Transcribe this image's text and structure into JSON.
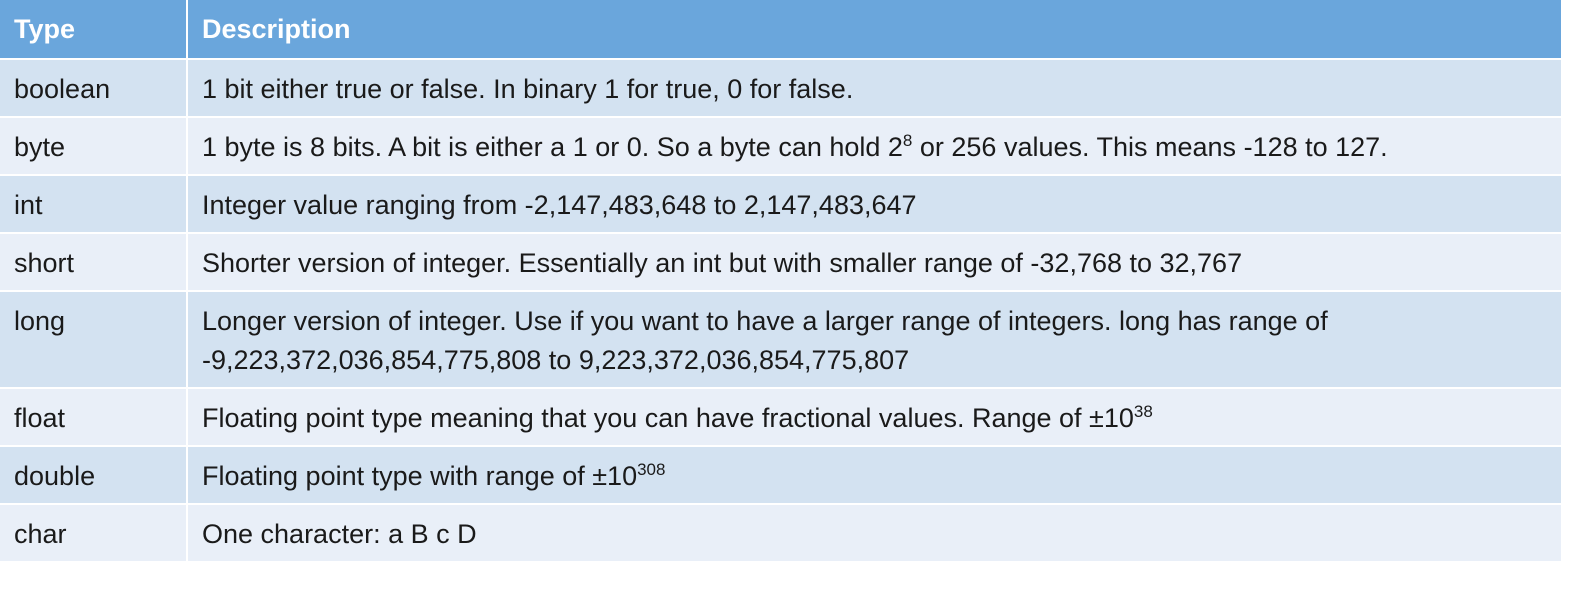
{
  "headers": {
    "type": "Type",
    "description": "Description"
  },
  "rows": [
    {
      "type": "boolean",
      "desc_pre": "1 bit either true or false. In binary 1 for true, 0 for false.",
      "sup": "",
      "desc_post": ""
    },
    {
      "type": "byte",
      "desc_pre": "1 byte is 8 bits. A bit is either a 1 or 0. So a byte can hold 2",
      "sup": "8",
      "desc_post": " or 256 values. This means -128 to 127."
    },
    {
      "type": "int",
      "desc_pre": "Integer value ranging from -2,147,483,648 to 2,147,483,647",
      "sup": "",
      "desc_post": ""
    },
    {
      "type": "short",
      "desc_pre": "Shorter version of integer. Essentially an int but with smaller range of -32,768 to 32,767",
      "sup": "",
      "desc_post": ""
    },
    {
      "type": "long",
      "desc_pre": "Longer version of integer. Use if you want to have a larger range of integers. long has range of -9,223,372,036,854,775,808 to 9,223,372,036,854,775,807",
      "sup": "",
      "desc_post": ""
    },
    {
      "type": "float",
      "desc_pre": "Floating point type meaning that you can have fractional values. Range of ±10",
      "sup": "38",
      "desc_post": ""
    },
    {
      "type": "double",
      "desc_pre": "Floating point type with range of ±10",
      "sup": "308",
      "desc_post": ""
    },
    {
      "type": "char",
      "desc_pre": "One character: a B c D",
      "sup": "",
      "desc_post": ""
    }
  ],
  "colors": {
    "header_bg": "#6aa6dc",
    "row_dark": "#d3e2f1",
    "row_light": "#e9eff8"
  }
}
